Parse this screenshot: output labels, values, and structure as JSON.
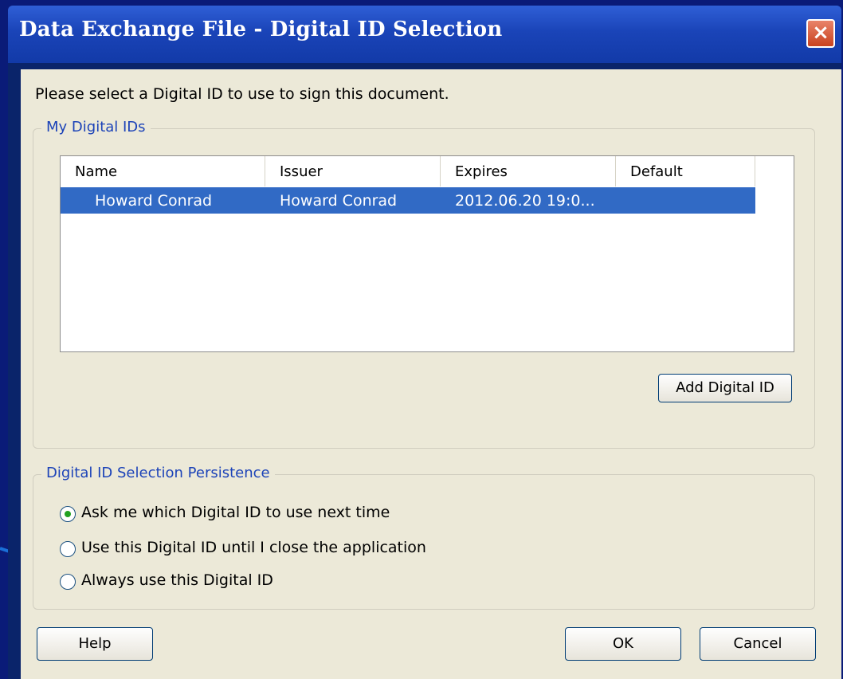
{
  "window": {
    "title": "Data Exchange File - Digital ID Selection",
    "close_glyph": "×"
  },
  "prompt": "Please select a Digital ID to use to sign this document.",
  "my_ids": {
    "group_label": "My Digital IDs",
    "columns": [
      "Name",
      "Issuer",
      "Expires",
      "Default"
    ],
    "rows": [
      {
        "name": "Howard Conrad",
        "issuer": "Howard Conrad",
        "expires": "2012.06.20 19:0...",
        "default": "",
        "selected": true
      }
    ],
    "add_button": "Add Digital ID"
  },
  "persistence": {
    "group_label": "Digital ID Selection Persistence",
    "options": [
      {
        "label": "Ask me which Digital ID to use next time",
        "selected": true
      },
      {
        "label": "Use this Digital ID until I close the application",
        "selected": false
      },
      {
        "label": "Always use this Digital ID",
        "selected": false
      }
    ]
  },
  "buttons": {
    "help": "Help",
    "ok": "OK",
    "cancel": "Cancel"
  },
  "colors": {
    "selection": "#316ac5",
    "arrow": "#1a6fd8",
    "group_label": "#1c43b8"
  }
}
